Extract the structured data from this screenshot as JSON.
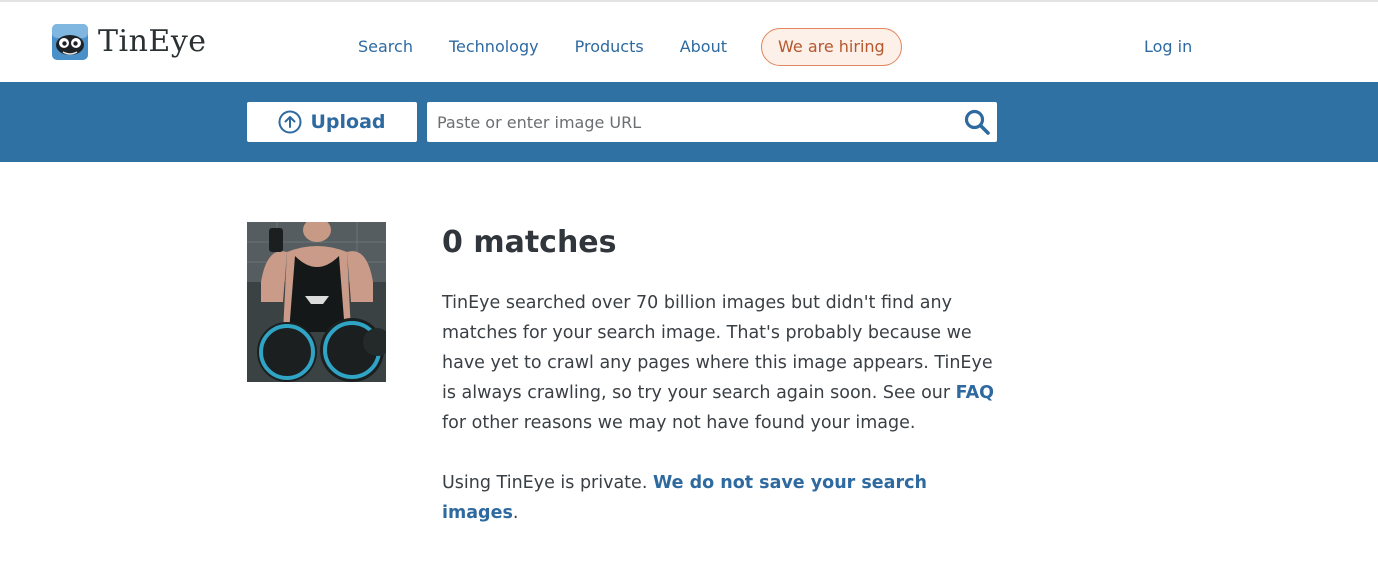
{
  "header": {
    "logo_text": "TinEye",
    "nav": [
      {
        "label": "Search"
      },
      {
        "label": "Technology"
      },
      {
        "label": "Products"
      },
      {
        "label": "About"
      }
    ],
    "hiring_label": "We are hiring",
    "login_label": "Log in"
  },
  "search": {
    "upload_label": "Upload",
    "url_placeholder": "Paste or enter image URL",
    "url_value": ""
  },
  "results": {
    "title": "0 matches",
    "message_part1": "TinEye searched over 70 billion images but didn't find any matches for your search image. That's probably because we have yet to crawl any pages where this image appears. TinEye is always crawling, so try your search again soon. See our ",
    "faq_link": "FAQ",
    "message_part2": " for other reasons we may not have found your image.",
    "privacy_text": "Using TinEye is private. ",
    "privacy_link": "We do not save your search images",
    "privacy_end": "."
  },
  "colors": {
    "brand_blue": "#2f71a3",
    "link_blue": "#2e6aa0",
    "hiring_orange": "#b4582e",
    "hiring_bg": "#fdf0e8"
  }
}
